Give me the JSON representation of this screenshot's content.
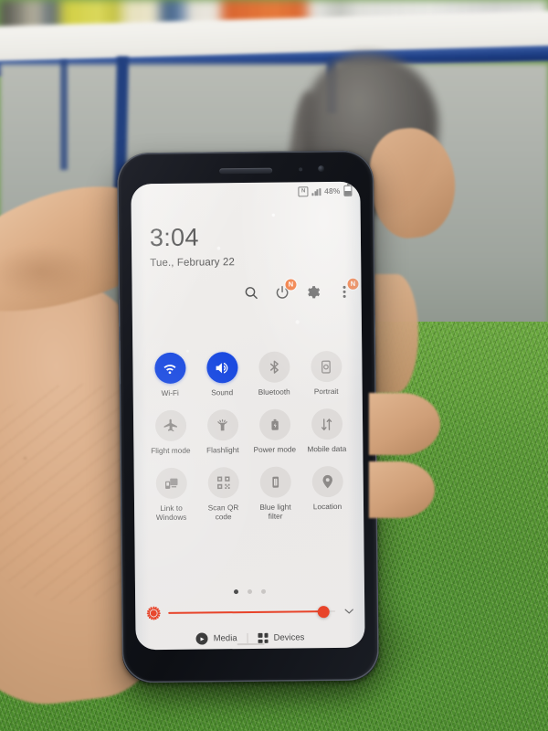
{
  "scene": {
    "description": "hand holding samsung galaxy phone over green artificial grass",
    "background_colors": {
      "grass": "#569330",
      "counter_edge": "#1e3f86",
      "counter_top": "#ecebe6",
      "wall": "#aeb2ac",
      "skin": "#d6a882"
    }
  },
  "phone": {
    "body_color": "#14161c",
    "screen_bg": "#eeecea"
  },
  "statusbar": {
    "nfc_icon": "nfc-icon",
    "nfc_glyph": "N",
    "signal_icon": "signal-bars-icon",
    "battery_percent": "48%",
    "battery_icon": "battery-icon"
  },
  "header": {
    "time": "3:04",
    "date": "Tue., February 22",
    "actions": [
      {
        "name": "search-icon",
        "badge": ""
      },
      {
        "name": "power-icon",
        "badge": "N"
      },
      {
        "name": "settings-gear-icon",
        "badge": ""
      },
      {
        "name": "more-options-icon",
        "badge": "N"
      }
    ]
  },
  "quick_settings": {
    "active_color": "#1a4ae0",
    "inactive_color": "#dedbd9",
    "tiles": [
      {
        "label": "Wi-Fi",
        "icon": "wifi-icon",
        "active": true
      },
      {
        "label": "Sound",
        "icon": "sound-icon",
        "active": true
      },
      {
        "label": "Bluetooth",
        "icon": "bluetooth-icon",
        "active": false
      },
      {
        "label": "Portrait",
        "icon": "portrait-rotation-icon",
        "active": false
      },
      {
        "label": "Flight\nmode",
        "icon": "airplane-icon",
        "active": false
      },
      {
        "label": "Flashlight",
        "icon": "flashlight-icon",
        "active": false
      },
      {
        "label": "Power\nmode",
        "icon": "power-mode-icon",
        "active": false
      },
      {
        "label": "Mobile\ndata",
        "icon": "mobile-data-icon",
        "active": false
      },
      {
        "label": "Link to\nWindows",
        "icon": "link-to-windows-icon",
        "active": false
      },
      {
        "label": "Scan QR\ncode",
        "icon": "qr-code-icon",
        "active": false
      },
      {
        "label": "Blue light\nfilter",
        "icon": "blue-light-filter-icon",
        "active": false
      },
      {
        "label": "Location",
        "icon": "location-pin-icon",
        "active": false
      }
    ],
    "page_count": 3,
    "active_page": 1
  },
  "brightness": {
    "icon": "brightness-sun-icon",
    "value_percent": 93,
    "slider_color": "#e8442a",
    "expand_icon": "chevron-down-icon"
  },
  "media_bar": {
    "media_label": "Media",
    "media_icon": "play-circle-icon",
    "devices_label": "Devices",
    "devices_icon": "devices-grid-icon"
  }
}
